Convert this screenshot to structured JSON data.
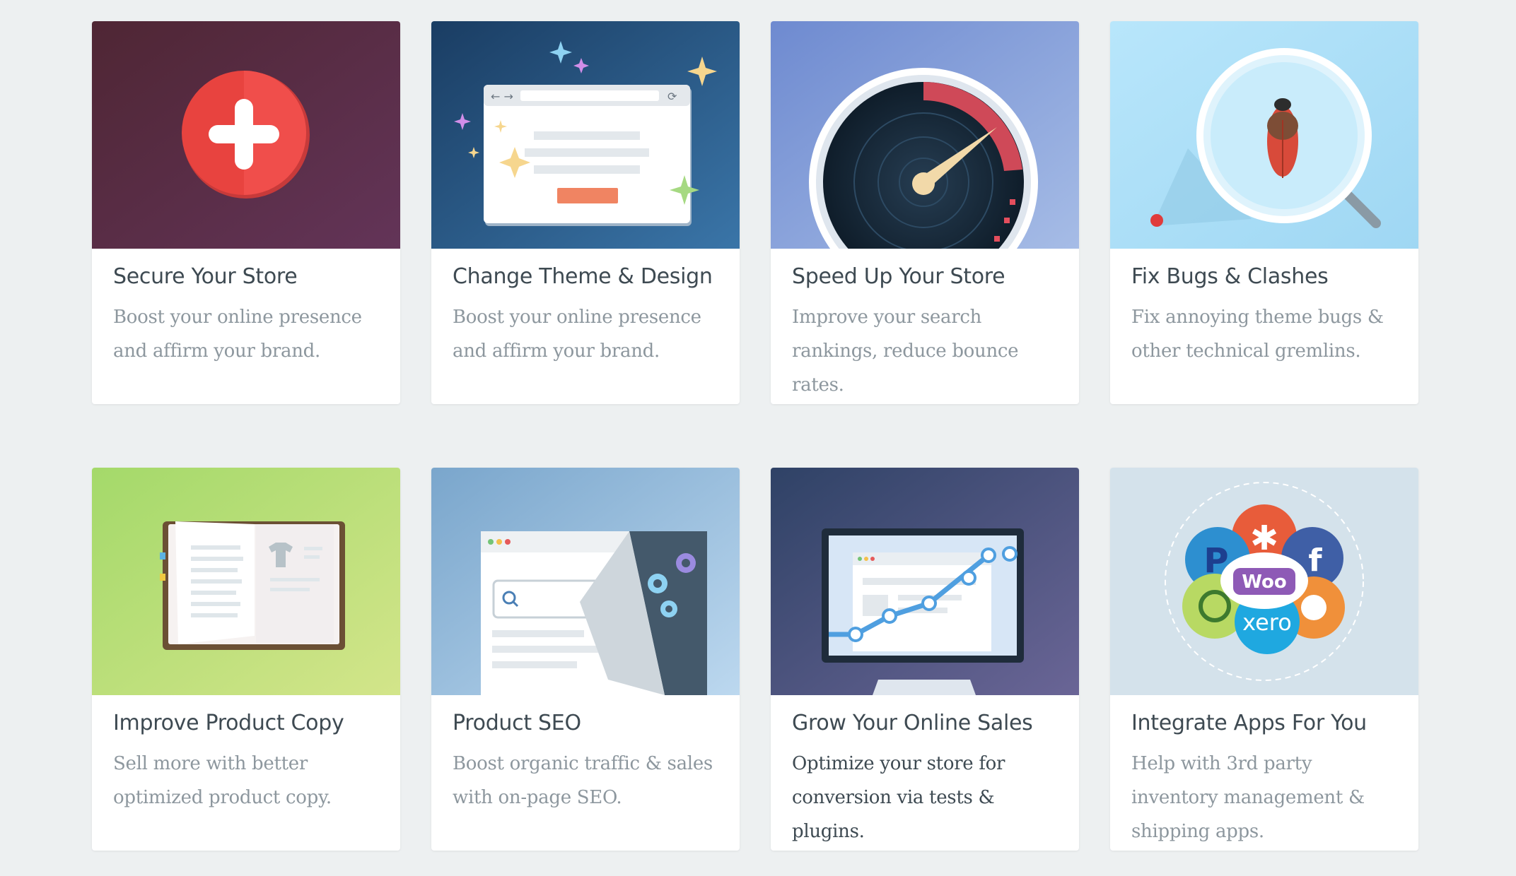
{
  "colors": {
    "background": "#edf0f1",
    "card": "#ffffff",
    "title": "#3e4a52",
    "description": "#8d979e",
    "description_active": "#3e4a52"
  },
  "cards": [
    {
      "title": "Secure Your Store",
      "description": "Boost your online presence and affirm your brand.",
      "icon": "medical-cross-icon",
      "bg": "#5a2d45"
    },
    {
      "title": "Change Theme & Design",
      "description": "Boost your online presence and affirm your brand.",
      "icon": "browser-window-icon",
      "bg": "#25527a"
    },
    {
      "title": "Speed Up Your Store",
      "description": "Improve your search rankings, reduce bounce rates.",
      "icon": "speedometer-icon",
      "bg": "#8aa2d6"
    },
    {
      "title": "Fix Bugs & Clashes",
      "description": "Fix annoying theme bugs & other technical gremlins.",
      "icon": "magnifier-bug-icon",
      "bg": "#a9dff7"
    },
    {
      "title": "Improve Product Copy",
      "description": "Sell more with better optimized product copy.",
      "icon": "open-book-icon",
      "bg": "#b5dc78"
    },
    {
      "title": "Product SEO",
      "description": "Boost organic traffic & sales with on-page SEO.",
      "icon": "search-page-icon",
      "bg": "#8fb6d8"
    },
    {
      "title": "Grow Your Online Sales",
      "description": "Optimize your store for conversion via tests & plugins.",
      "icon": "monitor-growth-chart-icon",
      "bg": "#4b5a88"
    },
    {
      "title": "Integrate Apps For You",
      "description": "Help with 3rd party inventory management & shipping apps.",
      "icon": "app-logos-cluster-icon",
      "bg": "#d3e1ea",
      "logos": [
        "P",
        "f",
        "Woo",
        "xero"
      ]
    }
  ]
}
